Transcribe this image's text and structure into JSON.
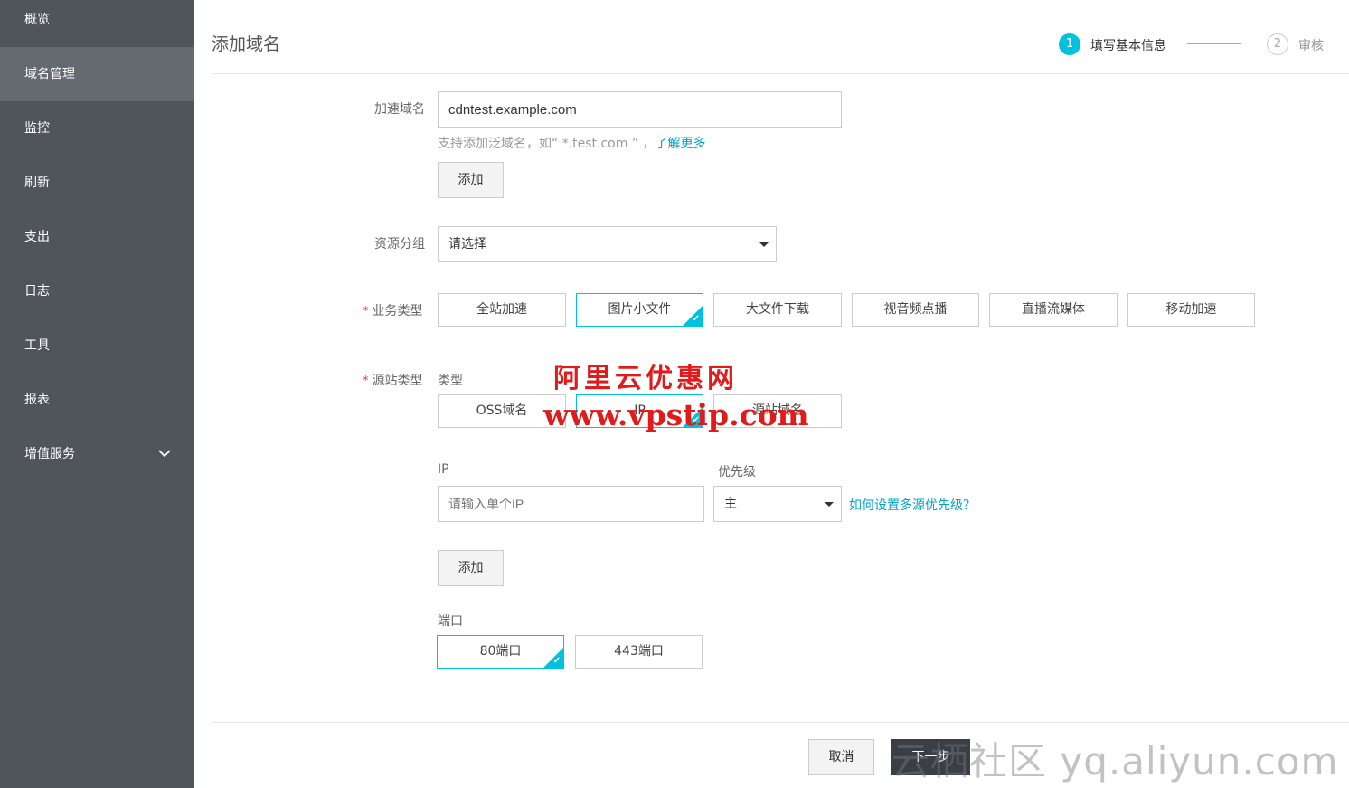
{
  "sidebar": {
    "items": [
      {
        "label": "概览"
      },
      {
        "label": "域名管理"
      },
      {
        "label": "监控"
      },
      {
        "label": "刷新"
      },
      {
        "label": "支出"
      },
      {
        "label": "日志"
      },
      {
        "label": "工具"
      },
      {
        "label": "报表"
      },
      {
        "label": "增值服务"
      }
    ]
  },
  "header": {
    "title": "添加域名",
    "steps": [
      {
        "number": "1",
        "label": "填写基本信息"
      },
      {
        "number": "2",
        "label": "审核"
      }
    ]
  },
  "form": {
    "domain": {
      "label": "加速域名",
      "value": "cdntest.example.com",
      "hint": "支持添加泛域名，如“ *.test.com ” ，",
      "hint_link": "了解更多",
      "add_button": "添加"
    },
    "resource_group": {
      "label": "资源分组",
      "selected": "请选择"
    },
    "business_type": {
      "required_mark": "*",
      "label": "业务类型",
      "options": [
        "全站加速",
        "图片小文件",
        "大文件下载",
        "视音频点播",
        "直播流媒体",
        "移动加速"
      ],
      "selected": "图片小文件"
    },
    "origin_type": {
      "required_mark": "*",
      "label": "源站类型",
      "sub_label": "类型",
      "options": [
        "OSS域名",
        "IP",
        "源站域名"
      ],
      "selected": "IP"
    },
    "ip": {
      "label": "IP",
      "placeholder": "请输入单个IP"
    },
    "priority": {
      "label": "优先级",
      "selected": "主",
      "help_link": "如何设置多源优先级？"
    },
    "add_origin_button": "添加",
    "port": {
      "label": "端口",
      "options": [
        "80端口",
        "443端口"
      ],
      "selected": "80端口"
    }
  },
  "footer": {
    "cancel": "取消",
    "next": "下一步"
  },
  "watermarks": {
    "line1": "阿里云优惠网",
    "line2": "www.vpstip.com",
    "line3": "云栖社区 yq.aliyun.com"
  },
  "colors": {
    "sidebar_bg": "#50555b",
    "sidebar_active": "#656a70",
    "accent": "#00c1de",
    "link": "#00a2ca",
    "required": "#e4393c",
    "watermark_red": "#e01b1b"
  }
}
